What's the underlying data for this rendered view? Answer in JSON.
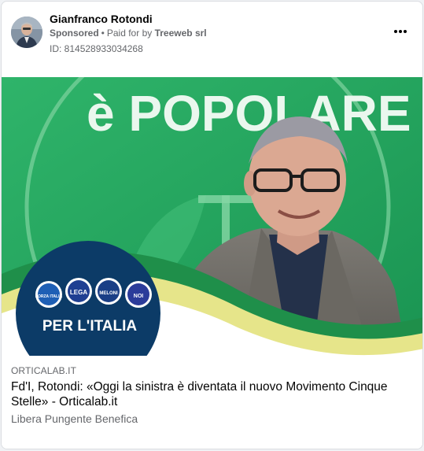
{
  "post": {
    "author_name": "Gianfranco Rotondi",
    "sponsored_label": "Sponsored",
    "separator": "•",
    "paid_for_prefix": "Paid for by",
    "paid_for_name": "Treeweb srl",
    "ad_id": "ID: 814528933034268",
    "more_icon": "more-horizontal-icon"
  },
  "image": {
    "banner_text": "è POPOLARE",
    "badge_text": "PER L'ITALIA",
    "party_logos": [
      {
        "label": "FORZA ITALIA",
        "color": "#1e5fb5"
      },
      {
        "label": "LEGA",
        "color": "#1f3f92"
      },
      {
        "label": "MELONI",
        "color": "#1a3f86"
      },
      {
        "label": "NOI",
        "color": "#2b3c9a"
      }
    ],
    "colors": {
      "green": "#1fa35a",
      "light_green": "#5bc47e",
      "yellow": "#e6e58a",
      "navy": "#0c3b67"
    }
  },
  "link": {
    "domain": "ORTICALAB.IT",
    "headline": "Fd'I, Rotondi: «Oggi la sinistra è diventata il nuovo Movimento Cinque Stelle» - Orticalab.it",
    "description": "Libera Pungente Benefica"
  }
}
